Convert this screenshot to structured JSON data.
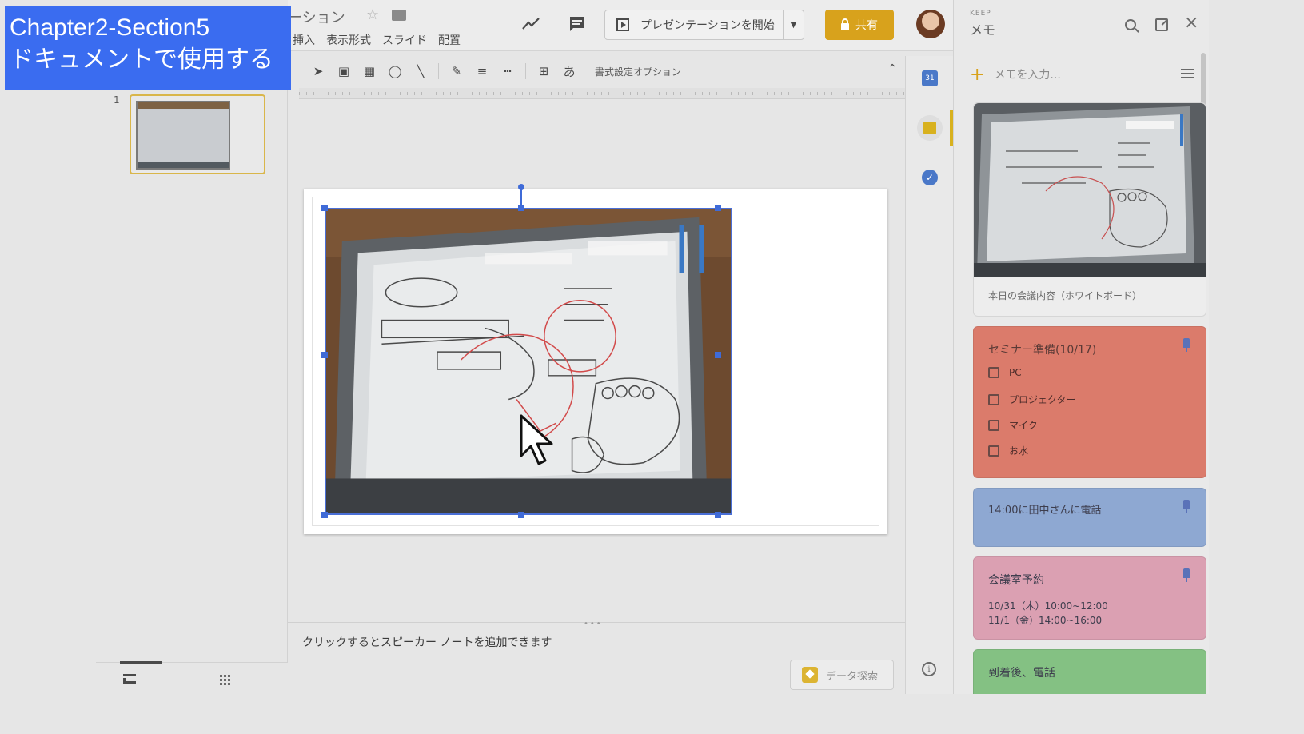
{
  "overlay": {
    "line1": "Chapter2-Section5",
    "line2": "ドキュメントで使用する"
  },
  "header": {
    "doc_title": "ーション",
    "menu": [
      "挿入",
      "表示形式",
      "スライド",
      "配置"
    ],
    "present_label": "プレゼンテーションを開始",
    "share_label": "共有"
  },
  "toolbar": {
    "text_style": "あ",
    "format_options": "書式設定オプション"
  },
  "filmstrip": {
    "slide_number": "1"
  },
  "notes": {
    "placeholder": "クリックするとスピーカー ノートを追加できます",
    "explore_label": "データ探索"
  },
  "siderail": {
    "calendar_label": "31"
  },
  "keep": {
    "brand": "KEEP",
    "title": "メモ",
    "add_placeholder": "メモを入力...",
    "photo_note_caption": "本日の会議内容（ホワイトボード）",
    "seminar": {
      "title": "セミナー準備(10/17)",
      "items": [
        "PC",
        "プロジェクター",
        "マイク",
        "お水"
      ]
    },
    "call_note": "14:00に田中さんに電話",
    "room_note": {
      "title": "会議室予約",
      "lines": [
        "10/31（木）10:00~12:00",
        "11/1（金）14:00~16:00"
      ]
    },
    "arrive_note": "到着後、電話"
  },
  "colors": {
    "overlay_blue": "#3a6cf0",
    "share_yellow": "#d8a21c",
    "selection_blue": "#3f6bd8",
    "note_red": "#db7b6b",
    "note_blue": "#8ea8d2",
    "note_pink": "#dba0b2",
    "note_green": "#84c183"
  }
}
